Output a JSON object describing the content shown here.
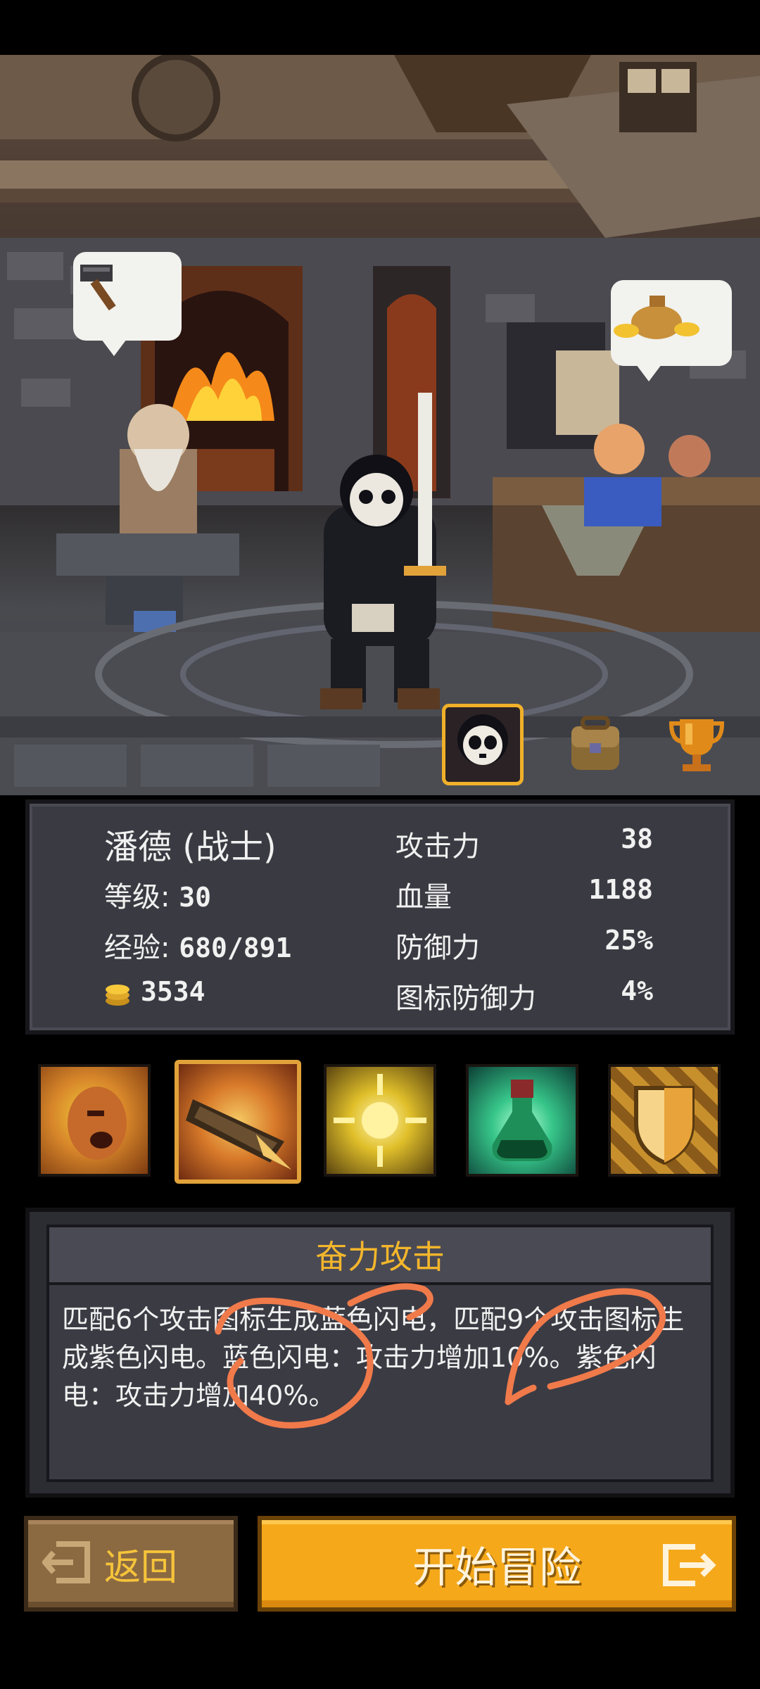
{
  "scene": {
    "bubbles": {
      "left_icon": "hammer-icon",
      "right_icon": "money-bag-icon"
    }
  },
  "tabs": [
    {
      "icon": "character-portrait-icon",
      "selected": true
    },
    {
      "icon": "backpack-icon",
      "selected": false
    },
    {
      "icon": "trophy-icon",
      "selected": false
    }
  ],
  "stats": {
    "name": "潘德 (战士)",
    "level_label": "等级:",
    "level_value": "30",
    "exp_label": "经验:",
    "exp_value": "680/891",
    "gold_value": "3534",
    "attributes": [
      {
        "label": "攻击力",
        "value": "38"
      },
      {
        "label": "血量",
        "value": "1188"
      },
      {
        "label": "防御力",
        "value": "25%"
      },
      {
        "label": "图标防御力",
        "value": "4%"
      }
    ]
  },
  "skills": [
    {
      "icon": "rage-face-skill-icon",
      "selected": false
    },
    {
      "icon": "power-strike-skill-icon",
      "selected": true
    },
    {
      "icon": "golden-burst-skill-icon",
      "selected": false
    },
    {
      "icon": "green-potion-skill-icon",
      "selected": false
    },
    {
      "icon": "shield-skill-icon",
      "selected": false
    }
  ],
  "description": {
    "title": "奋力攻击",
    "text": "匹配6个攻击图标生成蓝色闪电，匹配9个攻击图标生成紫色闪电。蓝色闪电：攻击力增加10%。紫色闪电：攻击力增加40%。"
  },
  "buttons": {
    "back_label": "返回",
    "start_label": "开始冒险"
  },
  "colors": {
    "accent": "#f5a81a",
    "title_gold": "#f3b62c",
    "annotation": "#f07a4a"
  }
}
